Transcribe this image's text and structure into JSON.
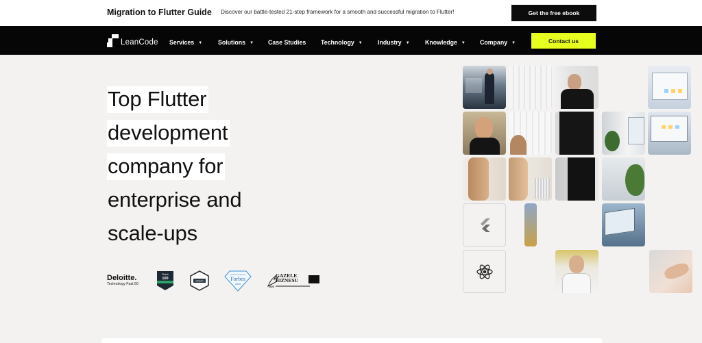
{
  "promo": {
    "title": "Migration to Flutter Guide",
    "text": "Discover our battle-tested 21-step framework for a smooth and successful migration to Flutter!",
    "button": "Get the free ebook"
  },
  "nav": {
    "logo": "LeanCode",
    "items": [
      {
        "label": "Services",
        "caret": "▼"
      },
      {
        "label": "Solutions",
        "caret": "▼"
      },
      {
        "label": "Case Studies",
        "caret": ""
      },
      {
        "label": "Technology",
        "caret": "▼"
      },
      {
        "label": "Industry",
        "caret": "▼"
      },
      {
        "label": "Knowledge",
        "caret": "▼"
      },
      {
        "label": "Company",
        "caret": "▼"
      }
    ],
    "contact": "Contact us"
  },
  "hero": {
    "lines": [
      "Top Flutter",
      "development",
      "company for",
      "enterprise and",
      "scale-ups"
    ]
  },
  "badges": {
    "deloitte_1": "Deloitte.",
    "deloitte_2": "Technology Fast 50",
    "clutch1_top": "Clutch",
    "clutch1_num": "100",
    "clutch2": "Clutch",
    "forbes_top": "Diamond Award",
    "forbes": "Forbes",
    "forbes_year": "2024",
    "gazele": "GAZELE",
    "biznesu": "BIZNESU",
    "gazele_year": "2023"
  },
  "colors": {
    "accent": "#e7ff1f",
    "nav_bg": "#060606",
    "page_bg": "#f3f2f1"
  }
}
